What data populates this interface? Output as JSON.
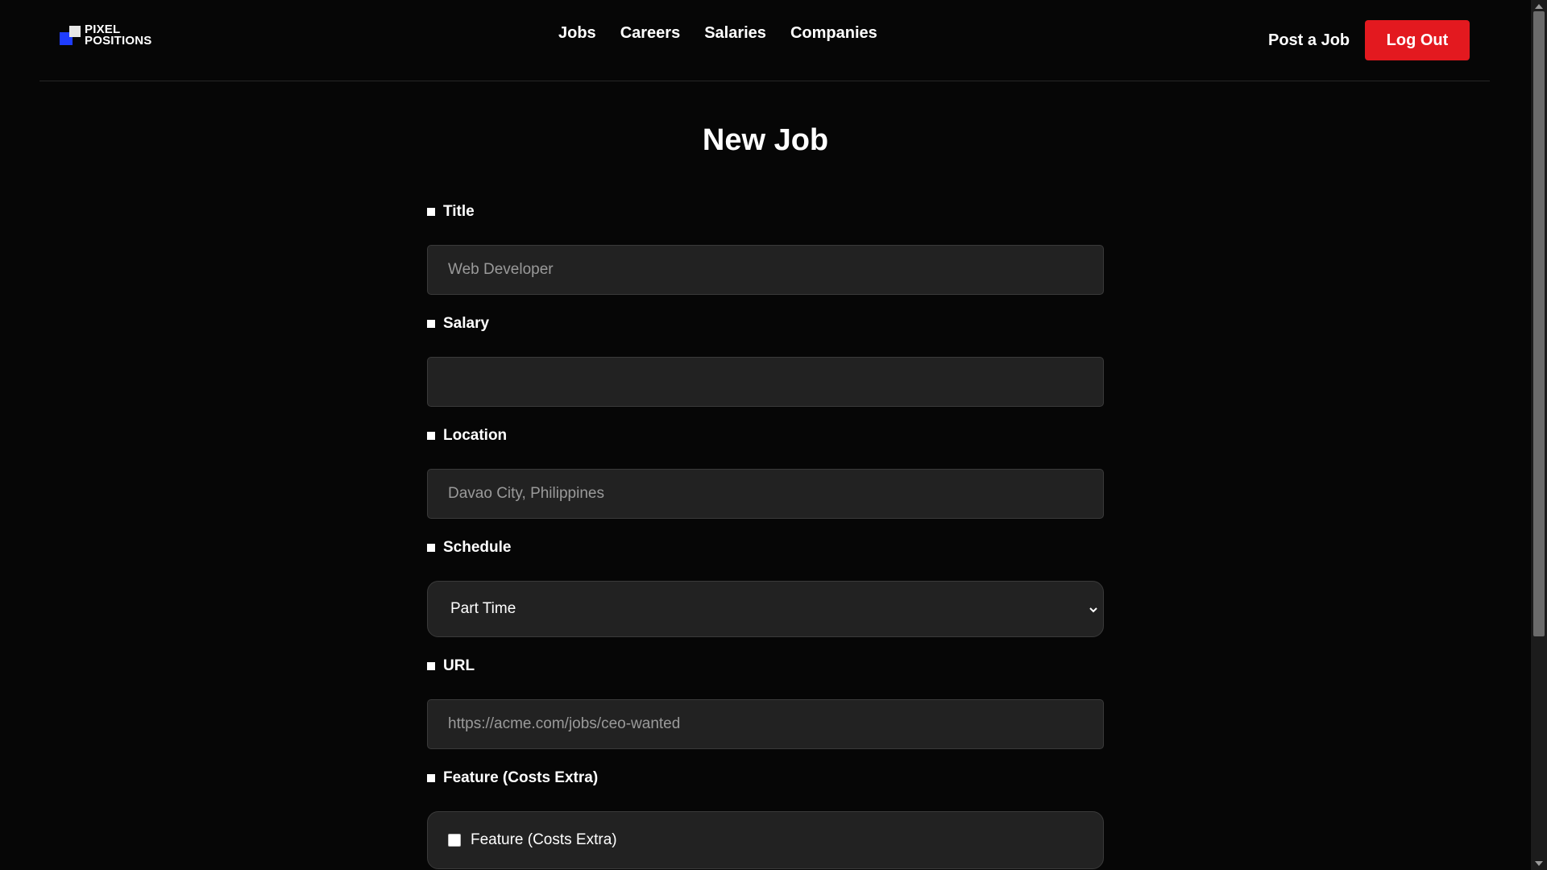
{
  "brand": {
    "line1": "PIXEL",
    "line2": "POSITIONS"
  },
  "nav": {
    "links": [
      "Jobs",
      "Careers",
      "Salaries",
      "Companies"
    ],
    "post_job": "Post a Job",
    "logout": "Log Out"
  },
  "page_title": "New Job",
  "form": {
    "title": {
      "label": "Title",
      "placeholder": "Web Developer"
    },
    "salary": {
      "label": "Salary",
      "placeholder": ""
    },
    "location": {
      "label": "Location",
      "placeholder": "Davao City, Philippines"
    },
    "schedule": {
      "label": "Schedule",
      "value": "Part Time"
    },
    "url": {
      "label": "URL",
      "placeholder": "https://acme.com/jobs/ceo-wanted"
    },
    "featured": {
      "label": "Feature (Costs Extra)",
      "checkbox_label": "Feature (Costs Extra)",
      "checked": false
    }
  },
  "colors": {
    "accent": "#e3191f",
    "logo_blue": "#1f3dff",
    "background": "#060606",
    "field_bg": "#222222"
  }
}
